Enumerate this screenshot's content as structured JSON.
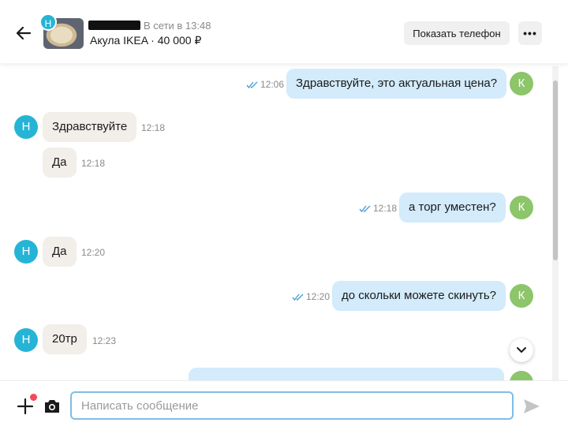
{
  "header": {
    "avatar_letter": "Н",
    "status": "В сети в 13:48",
    "listing": "Акула IKEA · 40 000 ₽",
    "phone_button": "Показать телефон",
    "more_button": "•••"
  },
  "messages": [
    {
      "side": "out",
      "text": "Здравствуйте, это актуальная цена?",
      "time": "12:06",
      "avatar": "К"
    },
    {
      "side": "in",
      "text": "Здравствуйте",
      "time": "12:18",
      "avatar": "Н"
    },
    {
      "side": "in",
      "text": "Да",
      "time": "12:18"
    },
    {
      "side": "out",
      "text": "а торг уместен?",
      "time": "12:18",
      "avatar": "К"
    },
    {
      "side": "in",
      "text": "Да",
      "time": "12:20",
      "avatar": "Н"
    },
    {
      "side": "out",
      "text": "до скольки можете скинуть?",
      "time": "12:20",
      "avatar": "К"
    },
    {
      "side": "in",
      "text": "20тр",
      "time": "12:23",
      "avatar": "Н"
    }
  ],
  "composer": {
    "placeholder": "Написать сообщение"
  },
  "colors": {
    "outgoing_bubble": "#d3ebfb",
    "incoming_bubble": "#f2eeea",
    "avatar_k": "#8cc56a",
    "avatar_n": "#26b4d6",
    "input_border": "#7fbde6"
  }
}
